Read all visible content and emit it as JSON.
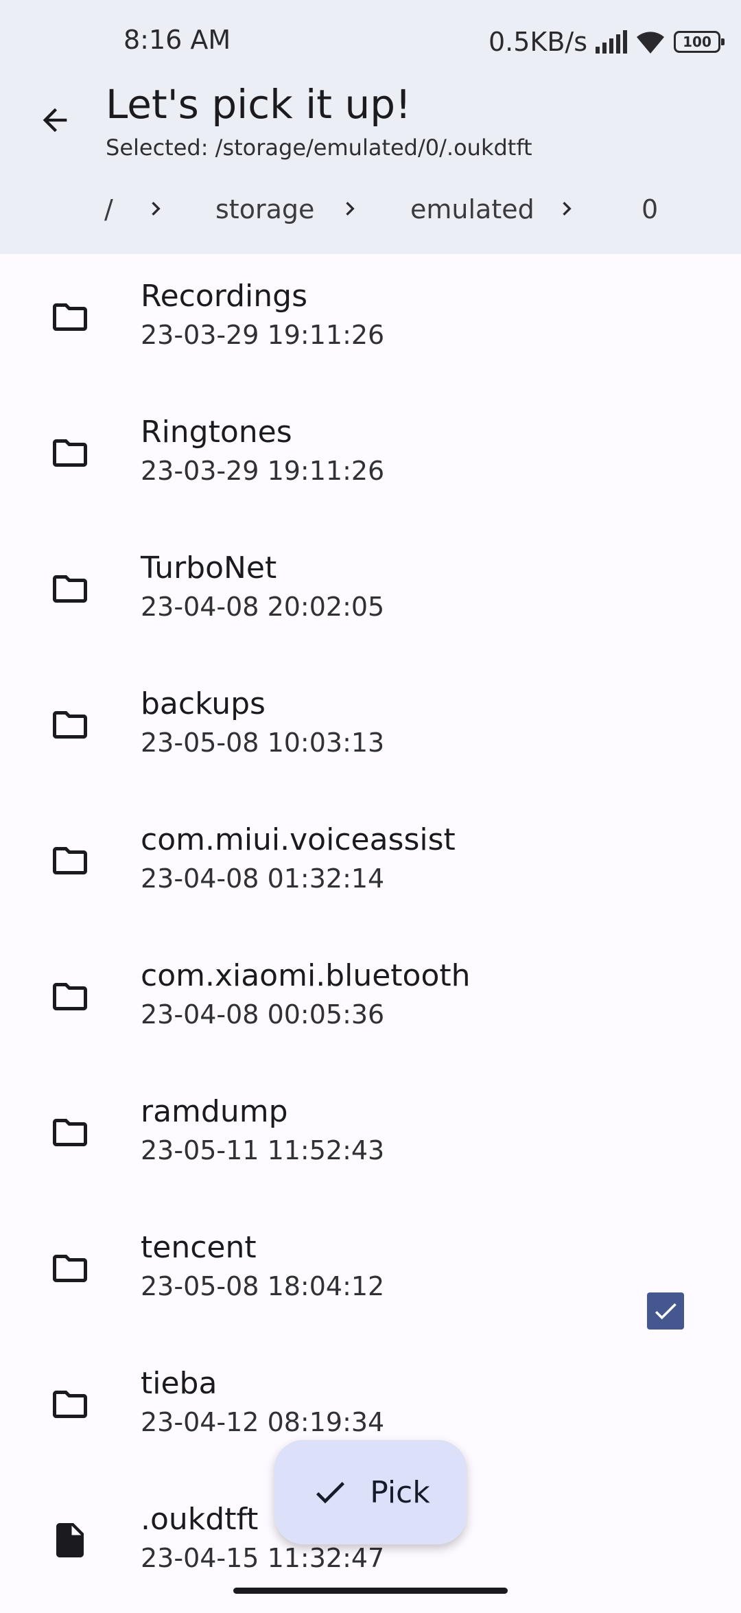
{
  "status_bar": {
    "time": "8:16 AM",
    "net_speed": "0.5KB/s",
    "battery": "100",
    "icons": [
      "signal-icon",
      "wifi-icon",
      "battery-icon"
    ]
  },
  "header": {
    "title": "Let's pick it up!",
    "subtitle": "Selected: /storage/emulated/0/.oukdtft",
    "back_icon": "back-arrow-icon"
  },
  "breadcrumb": {
    "items": [
      "/",
      "storage",
      "emulated",
      "0"
    ],
    "separator_icon": "chevron-right-icon"
  },
  "files": [
    {
      "name": "Recordings",
      "date": "23-03-29 19:11:26",
      "type": "folder"
    },
    {
      "name": "Ringtones",
      "date": "23-03-29 19:11:26",
      "type": "folder"
    },
    {
      "name": "TurboNet",
      "date": "23-04-08 20:02:05",
      "type": "folder"
    },
    {
      "name": "backups",
      "date": "23-05-08 10:03:13",
      "type": "folder"
    },
    {
      "name": "com.miui.voiceassist",
      "date": "23-04-08 01:32:14",
      "type": "folder"
    },
    {
      "name": "com.xiaomi.bluetooth",
      "date": "23-04-08 00:05:36",
      "type": "folder"
    },
    {
      "name": "ramdump",
      "date": "23-05-11 11:52:43",
      "type": "folder"
    },
    {
      "name": "tencent",
      "date": "23-05-08 18:04:12",
      "type": "folder"
    },
    {
      "name": "tieba",
      "date": "23-04-12 08:19:34",
      "type": "folder"
    },
    {
      "name": ".oukdtft",
      "date": "23-04-15 11:32:47",
      "type": "file",
      "checked": true
    }
  ],
  "fab": {
    "label": "Pick",
    "icon": "check-icon"
  },
  "colors": {
    "header_bg": "#eceef6",
    "page_bg": "#fdfbff",
    "fab_bg": "#dce1f9",
    "checkbox_bg": "#44588f"
  }
}
